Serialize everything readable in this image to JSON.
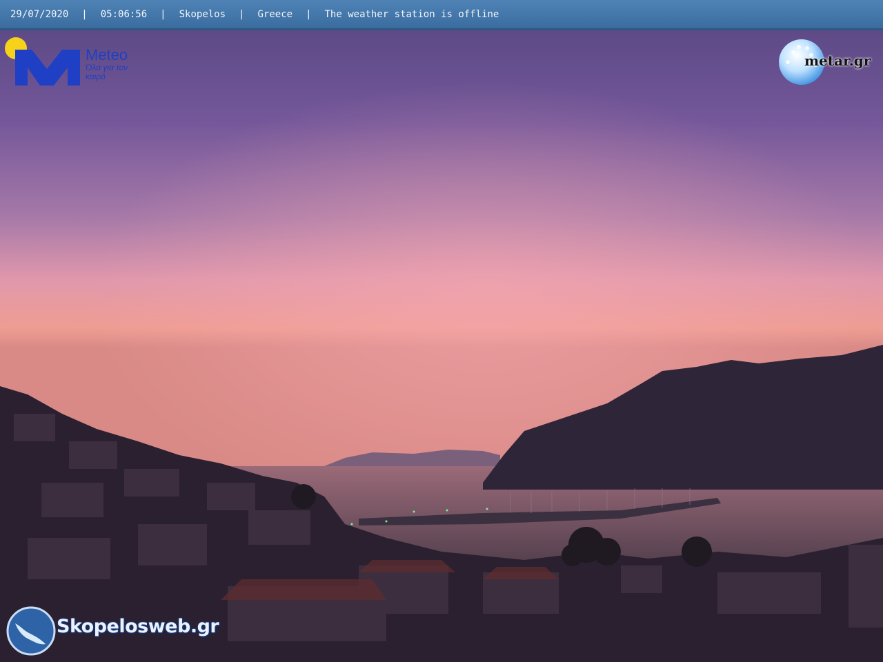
{
  "header": {
    "date": "29/07/2020",
    "time": "05:06:56",
    "location": "Skopelos",
    "country": "Greece",
    "status": "The weather station is offline",
    "separator": "|"
  },
  "meteo_logo": {
    "name": "Meteo",
    "tagline": "Όλα για τον καιρό",
    "color": "#1f3fc4"
  },
  "metar_logo": {
    "label": "metar.gr"
  },
  "skopelosweb_logo": {
    "label": "Skopelosweb.gr"
  },
  "colors": {
    "header_bg": "#3f73a8",
    "sky_top": "#5a4a86",
    "sky_mid": "#b07cae",
    "sky_horizon": "#ee9c8e",
    "mountain": "#2e2438",
    "sea": "#3a2e3e"
  }
}
